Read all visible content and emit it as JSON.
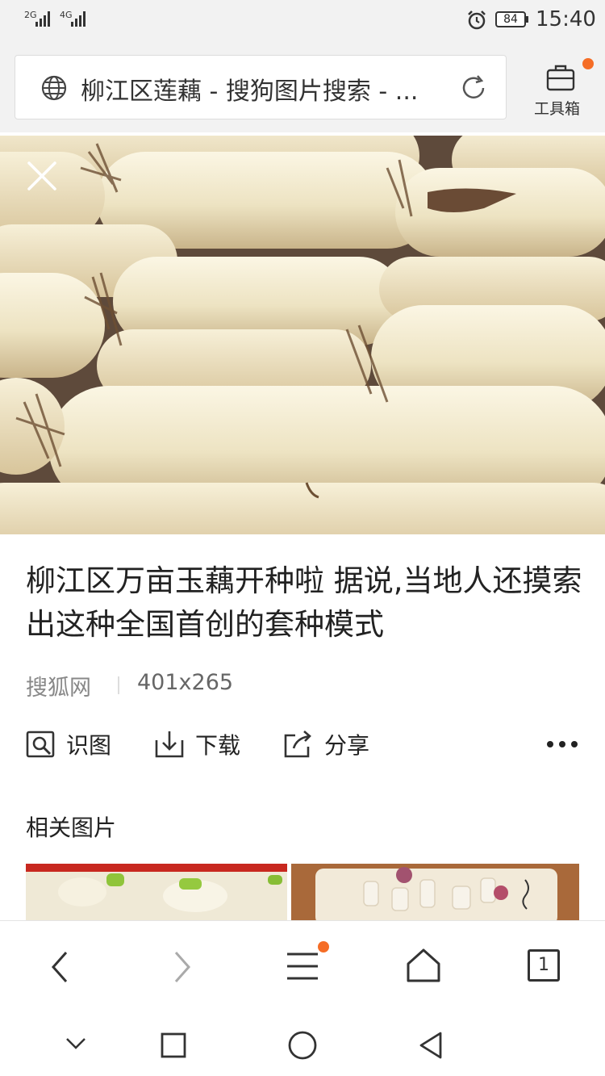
{
  "status_bar": {
    "sim1": "2G",
    "sim2": "4G",
    "battery": "84",
    "time": "15:40"
  },
  "browser": {
    "url_title": "柳江区莲藕 - 搜狗图片搜索 - ...",
    "toolbox_label": "工具箱"
  },
  "article": {
    "title": "柳江区万亩玉藕开种啦 据说,当地人还摸索出这种全国首创的套种模式",
    "source": "搜狐网",
    "dimensions": "401x265"
  },
  "actions": {
    "recognize": "识图",
    "download": "下载",
    "share": "分享"
  },
  "related": {
    "title": "相关图片"
  },
  "nav": {
    "tabs_count": "1"
  },
  "colors": {
    "accent_dot": "#f56d26"
  }
}
